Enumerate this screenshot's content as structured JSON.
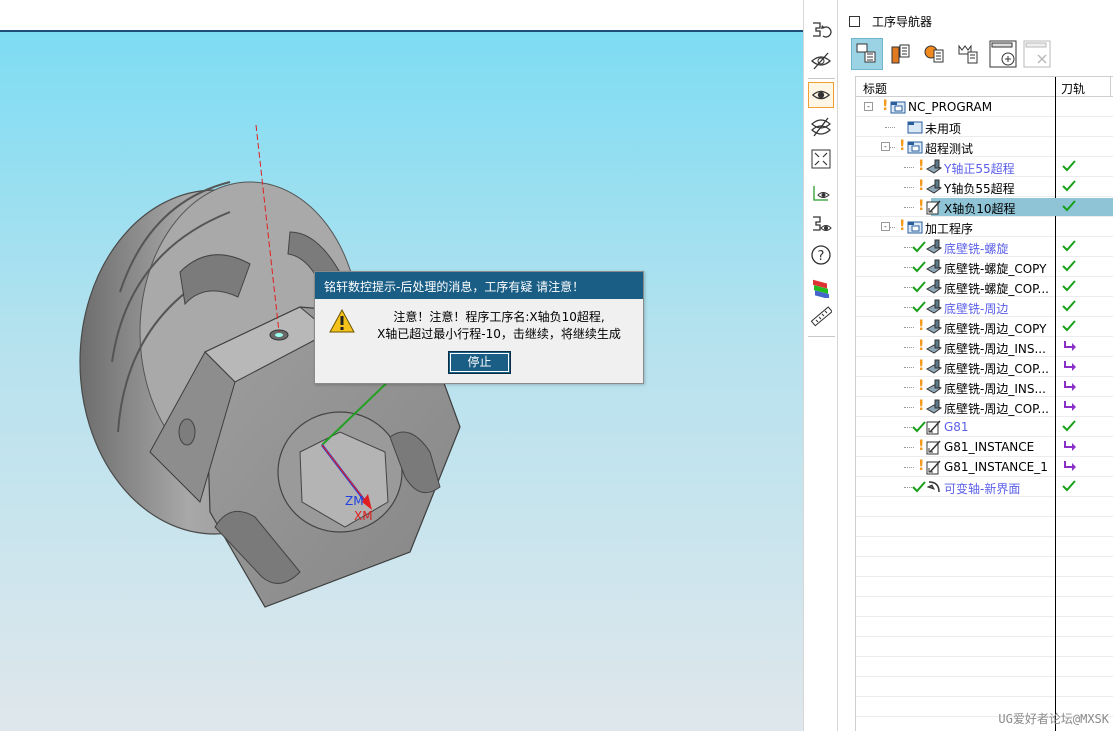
{
  "dialog": {
    "title": "铭轩数控提示-后处理的消息，工序有疑 请注意！",
    "message_line1": "注意！注意！程序工序名:X轴负10超程,",
    "message_line2": "X轴已超过最小行程-10，击继续，将继续生成",
    "stop_label": "停止"
  },
  "viewport": {
    "axis_labels": {
      "zm": "ZM",
      "xm": "XM"
    }
  },
  "resource_bar": {
    "icons": [
      "reuse-library-icon",
      "hide-icon",
      "show-icon",
      "hide-all-icon",
      "fit-view-icon",
      "view-orient-icon",
      "reuse-icon",
      "help-icon",
      "color-palette-icon",
      "ruler-icon"
    ]
  },
  "navigator": {
    "title": "工序导航器",
    "toolbar": [
      "program-order-view",
      "machine-tool-view",
      "geometry-view",
      "method-view",
      "create-operation",
      "delete"
    ],
    "columns": {
      "name": "标题",
      "path": "刀轨"
    },
    "rows": [
      {
        "label": "NC_PROGRAM",
        "level": 0,
        "icon": "program-folder",
        "mark": "bang",
        "expander": "-"
      },
      {
        "label": "未用项",
        "level": 1,
        "icon": "folder",
        "mark": "none"
      },
      {
        "label": "超程测试",
        "level": 1,
        "icon": "program-folder",
        "mark": "bang",
        "expander": "-"
      },
      {
        "label": "Y轴正55超程",
        "level": 2,
        "icon": "mill-op",
        "mark": "bang",
        "color": "blue",
        "status": "ok"
      },
      {
        "label": "Y轴负55超程",
        "level": 2,
        "icon": "mill-op",
        "mark": "bang",
        "status": "ok"
      },
      {
        "label": "X轴负10超程",
        "level": 2,
        "icon": "edit-op",
        "mark": "bang",
        "status": "ok",
        "selected": true
      },
      {
        "label": "加工程序",
        "level": 1,
        "icon": "program-folder",
        "mark": "bang",
        "expander": "-"
      },
      {
        "label": "底壁铣-螺旋",
        "level": 2,
        "icon": "mill-op",
        "mark": "tick",
        "color": "blue",
        "status": "ok"
      },
      {
        "label": "底壁铣-螺旋_COPY",
        "level": 2,
        "icon": "mill-op",
        "mark": "tick",
        "status": "ok"
      },
      {
        "label": "底壁铣-螺旋_COP...",
        "level": 2,
        "icon": "mill-op",
        "mark": "tick",
        "status": "ok"
      },
      {
        "label": "底壁铣-周边",
        "level": 2,
        "icon": "mill-op",
        "mark": "tick",
        "color": "blue",
        "status": "ok"
      },
      {
        "label": "底壁铣-周边_COPY",
        "level": 2,
        "icon": "mill-op",
        "mark": "bang",
        "status": "ok"
      },
      {
        "label": "底壁铣-周边_INS...",
        "level": 2,
        "icon": "mill-op",
        "mark": "bang",
        "status": "regen"
      },
      {
        "label": "底壁铣-周边_COP...",
        "level": 2,
        "icon": "mill-op",
        "mark": "bang",
        "status": "regen"
      },
      {
        "label": "底壁铣-周边_INS...",
        "level": 2,
        "icon": "mill-op",
        "mark": "bang",
        "status": "regen"
      },
      {
        "label": "底壁铣-周边_COP...",
        "level": 2,
        "icon": "mill-op",
        "mark": "bang",
        "status": "regen"
      },
      {
        "label": "G81",
        "level": 2,
        "icon": "edit-op",
        "mark": "tick",
        "color": "blue",
        "status": "ok"
      },
      {
        "label": "G81_INSTANCE",
        "level": 2,
        "icon": "edit-op",
        "mark": "bang",
        "status": "regen"
      },
      {
        "label": "G81_INSTANCE_1",
        "level": 2,
        "icon": "edit-op",
        "mark": "bang",
        "status": "regen"
      },
      {
        "label": "可变轴-新界面",
        "level": 2,
        "icon": "variable-axis-op",
        "mark": "tick",
        "color": "blue",
        "status": "ok"
      }
    ]
  },
  "watermark": "UG爱好者论坛@MXSK",
  "colors": {
    "dialog_title": "#1a5e86",
    "selected_row": "#8fc4d6",
    "ok": "#18a018",
    "regen": "#8b2fc9",
    "warning": "#f39a1c",
    "link_blue": "#5b5fe8"
  }
}
